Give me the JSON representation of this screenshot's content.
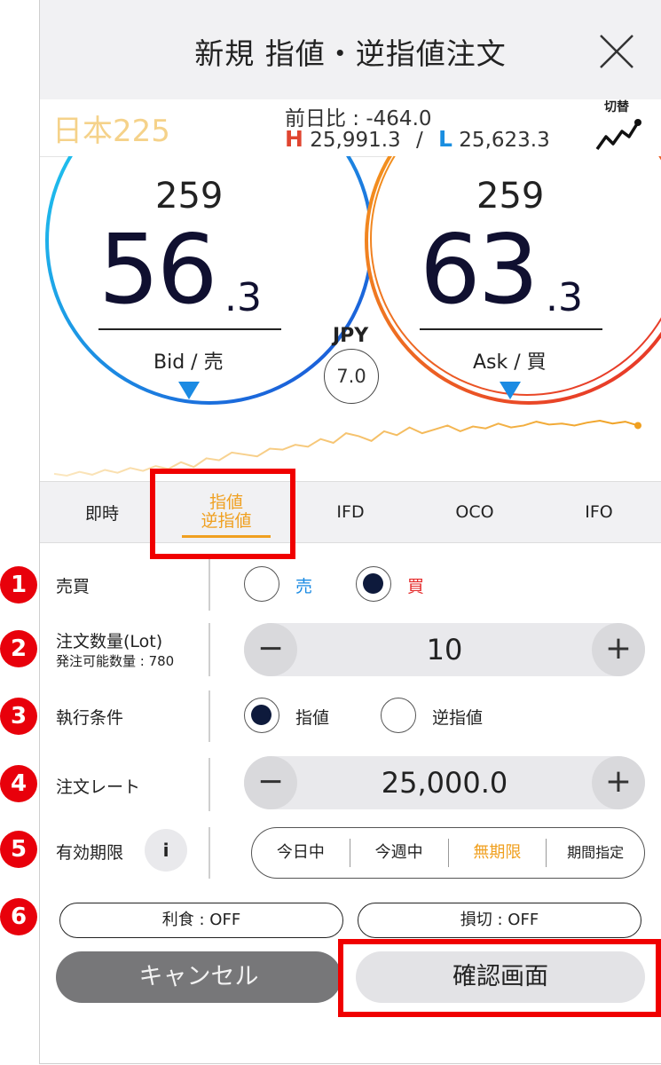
{
  "header": {
    "title": "新規 指値・逆指値注文"
  },
  "info": {
    "symbol": "日本225",
    "change": "前日比 : -464.0",
    "high_letter": "H",
    "high": "25,991.3",
    "slash": "/",
    "low_letter": "L",
    "low": "25,623.3",
    "switch_label": "切替"
  },
  "bid": {
    "prefix": "259",
    "main": "56",
    "decimal": ".3",
    "label": "Bid / 売"
  },
  "ask": {
    "prefix": "259",
    "main": "63",
    "decimal": ".3",
    "label": "Ask / 買"
  },
  "spread": {
    "currency": "JPY",
    "value": "7.0"
  },
  "tabs": [
    {
      "label": "即時"
    },
    {
      "label_line1": "指値",
      "label_line2": "逆指値"
    },
    {
      "label": "IFD"
    },
    {
      "label": "OCO"
    },
    {
      "label": "IFO"
    }
  ],
  "form": {
    "side": {
      "num": "1",
      "label": "売買",
      "sell": "売",
      "buy": "買",
      "selected": "buy"
    },
    "quantity": {
      "num": "2",
      "label": "注文数量(Lot)",
      "sub": "発注可能数量 : 780",
      "value": "10",
      "minus": "−",
      "plus": "+"
    },
    "condition": {
      "num": "3",
      "label": "執行条件",
      "limit": "指値",
      "stop": "逆指値",
      "selected": "limit"
    },
    "rate": {
      "num": "4",
      "label": "注文レート",
      "value": "25,000.0",
      "minus": "−",
      "plus": "+"
    },
    "expiry": {
      "num": "5",
      "label": "有効期限",
      "info": "i",
      "options": [
        "今日中",
        "今週中",
        "無期限",
        "期間指定"
      ],
      "selected": "無期限"
    },
    "exits": {
      "num": "6",
      "take_profit": "利食 : OFF",
      "stop_loss": "損切 : OFF"
    }
  },
  "buttons": {
    "cancel": "キャンセル",
    "confirm": "確認画面"
  },
  "colors": {
    "accent": "#f0a020",
    "bid": "#1b8be3",
    "ask": "#e52a2a",
    "highlight": "#f00000"
  },
  "spark": [
    8,
    6,
    10,
    7,
    12,
    9,
    14,
    11,
    16,
    13,
    20,
    15,
    24,
    22,
    30,
    28,
    26,
    34,
    33,
    38,
    36,
    44,
    40,
    50,
    47,
    42,
    52,
    48,
    56,
    50,
    54,
    58,
    52,
    57,
    55,
    60,
    56,
    58,
    62,
    59,
    60,
    58,
    61,
    63,
    60,
    62,
    58
  ]
}
